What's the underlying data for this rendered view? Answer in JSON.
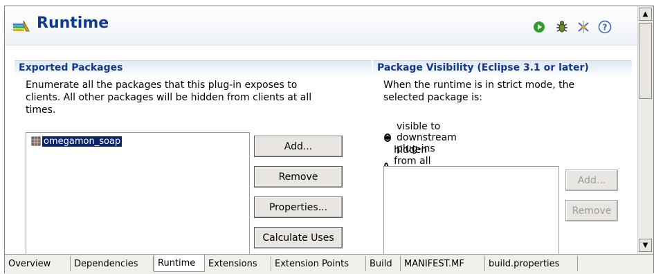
{
  "header": {
    "title": "Runtime"
  },
  "toolbar": {
    "icons": [
      "run-icon",
      "debug-icon",
      "profile-icon",
      "help-icon"
    ]
  },
  "exported": {
    "title": "Exported Packages",
    "description": "Enumerate all the packages that this plug-in exposes to clients.  All other packages will be hidden from clients at all times.",
    "desc_line1": "Enumerate all the packages that this plug-in exposes to",
    "desc_line2": "clients.  All other packages will be hidden from clients at all",
    "desc_line3": "times.",
    "packages": [
      {
        "name": "omegamon_soap",
        "selected": true
      }
    ],
    "buttons": {
      "add": "Add...",
      "remove": "Remove",
      "properties": "Properties...",
      "calculate": "Calculate Uses"
    }
  },
  "visibility": {
    "title": "Package Visibility (Eclipse 3.1 or later)",
    "desc_line1": "When the runtime is in strict mode, the",
    "desc_line2": "selected package is:",
    "radio_visible": "visible to downstream plug-ins",
    "radio_hidden": "hidden from all plug-ins except:",
    "selected_option": "visible",
    "buttons": {
      "add": "Add...",
      "remove": "Remove"
    }
  },
  "tabs": [
    {
      "label": "Overview",
      "active": false
    },
    {
      "label": "Dependencies",
      "active": false
    },
    {
      "label": "Runtime",
      "active": true
    },
    {
      "label": "Extensions",
      "active": false
    },
    {
      "label": "Extension Points",
      "active": false
    },
    {
      "label": "Build",
      "active": false
    },
    {
      "label": "MANIFEST.MF",
      "active": false
    },
    {
      "label": "build.properties",
      "active": false
    }
  ],
  "colors": {
    "title": "#0f3b8a",
    "selection": "#0a246a"
  }
}
